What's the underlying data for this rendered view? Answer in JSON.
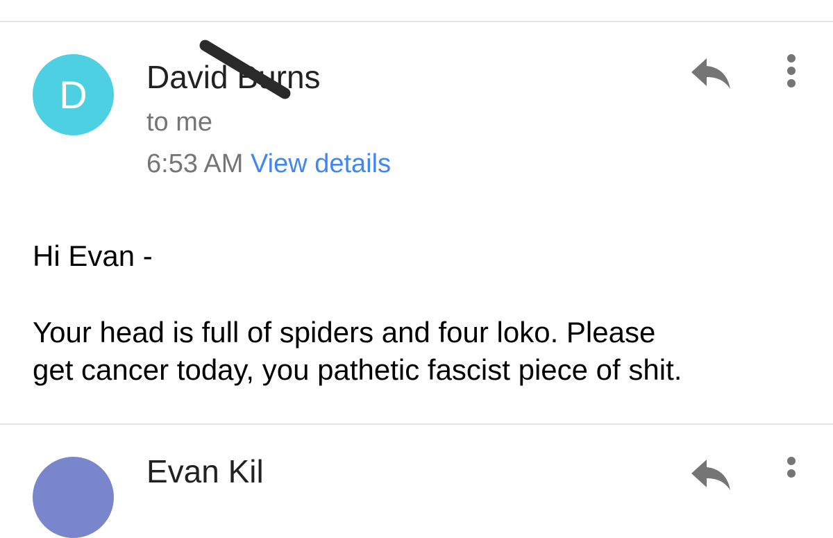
{
  "message": {
    "avatar_letter": "D",
    "sender_name": "David Burns",
    "recipient": "to me",
    "time": "6:53 AM",
    "view_details_label": "View details",
    "greeting": "Hi Evan -",
    "body": "Your head is full of spiders and four loko.  Please\nget cancer today, you pathetic fascist piece of shit.",
    "reply_icon": "reply-icon",
    "more_icon": "more-vert-icon"
  },
  "next_message": {
    "sender_name": "Evan Kil"
  },
  "colors": {
    "avatar_main": "#4dd0e1",
    "avatar_next": "#7986cb",
    "link": "#4285f4",
    "secondary_text": "#757575",
    "icon": "#757575"
  }
}
